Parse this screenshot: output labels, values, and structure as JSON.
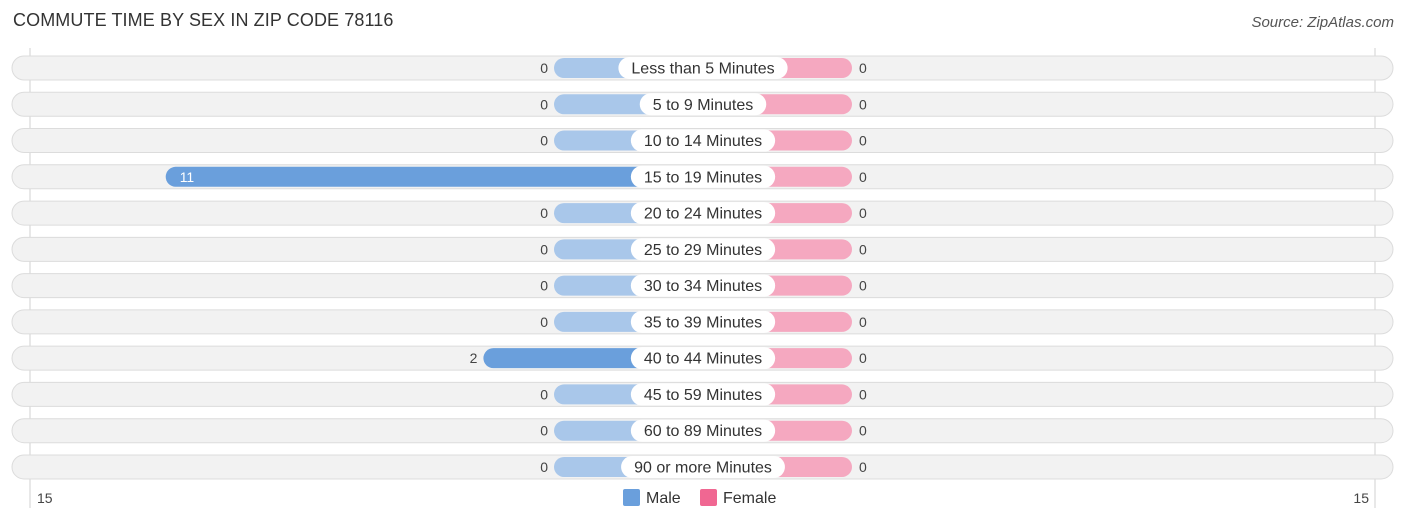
{
  "chart_data": {
    "type": "bar",
    "orientation": "horizontal-diverging",
    "title": "COMMUTE TIME BY SEX IN ZIP CODE 78116",
    "source": "Source: ZipAtlas.com",
    "categories": [
      "Less than 5 Minutes",
      "5 to 9 Minutes",
      "10 to 14 Minutes",
      "15 to 19 Minutes",
      "20 to 24 Minutes",
      "25 to 29 Minutes",
      "30 to 34 Minutes",
      "35 to 39 Minutes",
      "40 to 44 Minutes",
      "45 to 59 Minutes",
      "60 to 89 Minutes",
      "90 or more Minutes"
    ],
    "series": [
      {
        "name": "Male",
        "color": "#6a9fdc",
        "light_color": "#a9c7ea",
        "values": [
          0,
          0,
          0,
          11,
          0,
          0,
          0,
          0,
          2,
          0,
          0,
          0
        ]
      },
      {
        "name": "Female",
        "color": "#f06792",
        "light_color": "#f5a8c0",
        "values": [
          0,
          0,
          0,
          0,
          0,
          0,
          0,
          0,
          0,
          0,
          0,
          0
        ]
      }
    ],
    "axis": {
      "left_tick": "15",
      "right_tick": "15",
      "range": [
        -15,
        15
      ]
    },
    "legend": {
      "position": "bottom-center",
      "items": [
        "Male",
        "Female"
      ]
    }
  }
}
